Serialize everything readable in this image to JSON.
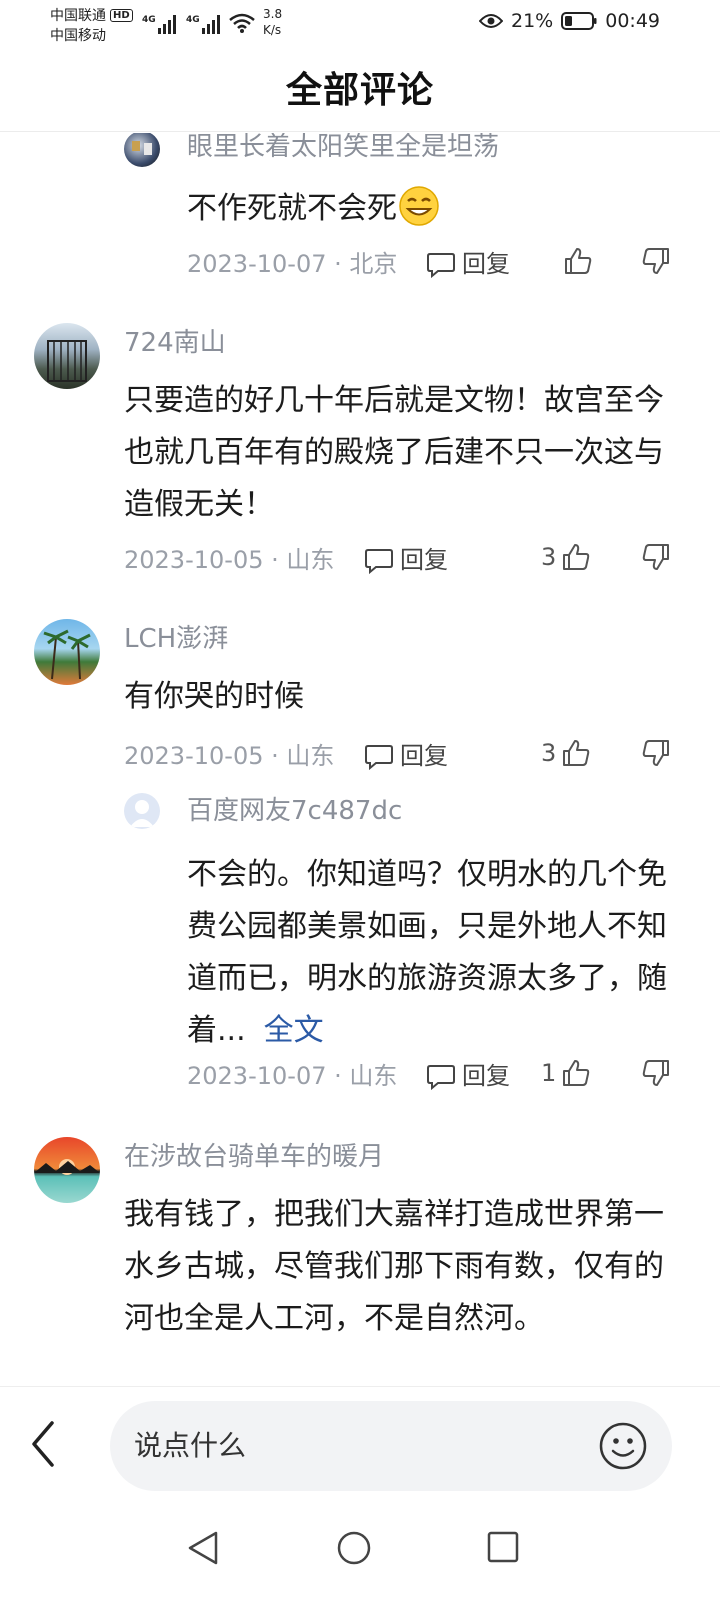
{
  "status_bar": {
    "carrier1": "中国联通",
    "hd": "HD",
    "carrier2": "中国移动",
    "net1": "4G",
    "net2": "4G",
    "speed_value": "3.8",
    "speed_unit": "K/s",
    "battery": "21%",
    "time": "00:49"
  },
  "header": {
    "title": "全部评论"
  },
  "comments": [
    {
      "username": "眼里长着太阳笑里全是坦荡",
      "text": "不作死就不会死",
      "meta": "2023-10-07 · 北京",
      "reply_label": "回复",
      "likes": ""
    },
    {
      "username": "724南山",
      "text": "只要造的好几十年后就是文物！故宫至今也就几百年有的殿烧了后建不只一次这与造假无关！",
      "meta": "2023-10-05 · 山东",
      "reply_label": "回复",
      "likes": "3"
    },
    {
      "username": "LCH澎湃",
      "text": "有你哭的时候",
      "meta": "2023-10-05 · 山东",
      "reply_label": "回复",
      "likes": "3"
    },
    {
      "username": "百度网友7c487dc",
      "text": "不会的。你知道吗？仅明水的几个免费公园都美景如画，只是外地人不知道而已，明水的旅游资源太多了，随着...",
      "fulltext": "全文",
      "meta": "2023-10-07 · 山东",
      "reply_label": "回复",
      "likes": "1"
    },
    {
      "username": "在涉故台骑单车的暖月",
      "text": "我有钱了，把我们大嘉祥打造成世界第一水乡古城，尽管我们那下雨有数，仅有的河也全是人工河，不是自然河。",
      "meta": "",
      "reply_label": "",
      "likes": ""
    }
  ],
  "input": {
    "placeholder": "说点什么"
  },
  "colors": {
    "accent_link": "#2b5aa6",
    "meta_gray": "#9a9fa8"
  },
  "icons": [
    "eye-icon",
    "battery-icon",
    "comment-icon",
    "thumb-up-icon",
    "thumb-down-icon",
    "back-chevron-icon",
    "smiley-icon",
    "nav-back-icon",
    "nav-home-icon",
    "nav-recents-icon"
  ]
}
